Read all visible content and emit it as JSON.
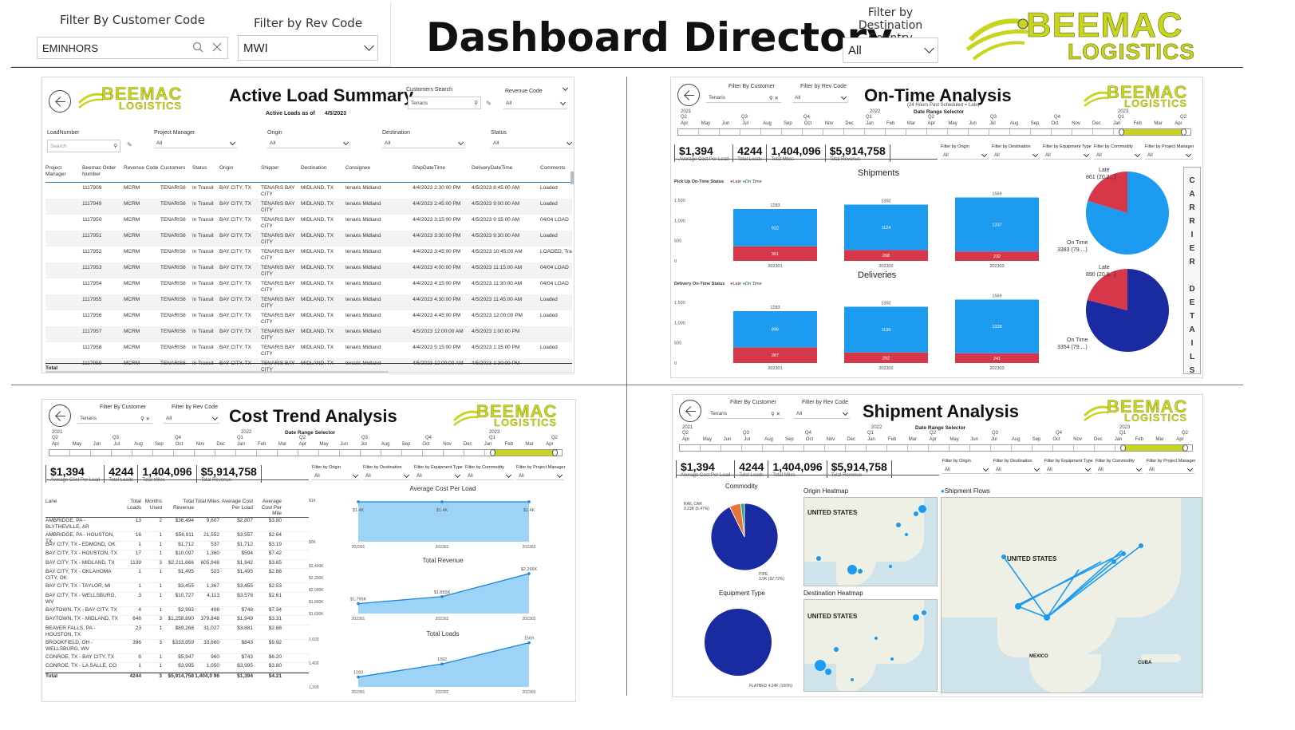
{
  "header": {
    "filter_customer_label": "Filter By Customer Code",
    "filter_customer_value": "EMINHORS",
    "filter_rev_label": "Filter by Rev Code",
    "filter_rev_value": "MWI",
    "title": "Dashboard Directory",
    "filter_dest_label": "Filter by Destination Country",
    "filter_dest_value": "All",
    "logo_top": "BEEMAC",
    "logo_bottom": "LOGISTICS"
  },
  "logo_small": {
    "top": "BEEMAC",
    "bottom": "LOGISTICS"
  },
  "active": {
    "title": "Active Load Summary",
    "as_of_label": "Active Loads as of",
    "as_of_date": "4/5/2023",
    "customers_search_label": "Customers Search",
    "customers_search_value": "Tenaris",
    "revenue_code_label": "Revenue Code",
    "revenue_code_value": "All",
    "loadnumber_label": "LoadNumber",
    "search_placeholder": "Search",
    "filters": [
      {
        "label": "Project Manager",
        "value": "All"
      },
      {
        "label": "Origin",
        "value": "All"
      },
      {
        "label": "Destination",
        "value": "All"
      },
      {
        "label": "Status",
        "value": "All"
      }
    ],
    "columns": [
      "Project Manager",
      "Beemac Order Number",
      "Revenue Code",
      "Customers",
      "Status",
      "Origin",
      "Shipper",
      "Destination",
      "Consignee",
      "ShipDateTime",
      "DeliveryDateTime",
      "Comments"
    ],
    "rows": [
      [
        "",
        "1117909",
        "MCRM",
        "TENARIS6",
        "In Transit",
        "BAY CITY, TX",
        "TENARIS BAY CITY",
        "MIDLAND, TX",
        "tenaris Midland",
        "4/4/2023 2:30:00 PM",
        "4/5/2023 8:45:00 AM",
        "Loaded"
      ],
      [
        "",
        "1117949",
        "MCRM",
        "TENARIS6",
        "In Transit",
        "BAY CITY, TX",
        "TENARIS BAY CITY",
        "MIDLAND, TX",
        "tenaris Midland",
        "4/4/2023 2:45:00 PM",
        "4/5/2023 9:00:00 AM",
        "Loaded"
      ],
      [
        "",
        "1117950",
        "MCRM",
        "TENARIS6",
        "In Transit",
        "BAY CITY, TX",
        "TENARIS BAY CITY",
        "MIDLAND, TX",
        "tenaris Midland",
        "4/4/2023 3:15:00 PM",
        "4/5/2023 9:15:00 AM",
        "04/04 LOAD"
      ],
      [
        "",
        "1117951",
        "MCRM",
        "TENARIS6",
        "In Transit",
        "BAY CITY, TX",
        "TENARIS BAY CITY",
        "MIDLAND, TX",
        "tenaris Midland",
        "4/4/2023 3:30:00 PM",
        "4/5/2023 9:30:00 AM",
        "Loaded"
      ],
      [
        "",
        "1117952",
        "MCRM",
        "TENARIS6",
        "In Transit",
        "BAY CITY, TX",
        "TENARIS BAY CITY",
        "MIDLAND, TX",
        "tenaris Midland",
        "4/4/2023 3:45:00 PM",
        "4/5/2023 10:45:00 AM",
        "LOADED, Tra"
      ],
      [
        "",
        "1117953",
        "MCRM",
        "TENARIS6",
        "In Transit",
        "BAY CITY, TX",
        "TENARIS BAY CITY",
        "MIDLAND, TX",
        "tenaris Midland",
        "4/4/2023 4:00:00 PM",
        "4/5/2023 11:15:00 AM",
        "04/04 LOAD"
      ],
      [
        "",
        "1117954",
        "MCRM",
        "TENARIS6",
        "In Transit",
        "BAY CITY, TX",
        "TENARIS BAY CITY",
        "MIDLAND, TX",
        "tenaris Midland",
        "4/4/2023 4:15:00 PM",
        "4/5/2023 11:30:00 AM",
        "04/04 LOAD"
      ],
      [
        "",
        "1117955",
        "MCRM",
        "TENARIS6",
        "In Transit",
        "BAY CITY, TX",
        "TENARIS BAY CITY",
        "MIDLAND, TX",
        "tenaris Midland",
        "4/4/2023 4:30:00 PM",
        "4/5/2023 11:45:00 AM",
        "Loaded"
      ],
      [
        "",
        "1117956",
        "MCRM",
        "TENARIS6",
        "In Transit",
        "BAY CITY, TX",
        "TENARIS BAY CITY",
        "MIDLAND, TX",
        "tenaris Midland",
        "4/4/2023 4:45:00 PM",
        "4/5/2023 12:00:00 PM",
        "Loaded"
      ],
      [
        "",
        "1117957",
        "MCRM",
        "TENARIS6",
        "In Transit",
        "BAY CITY, TX",
        "TENARIS BAY CITY",
        "MIDLAND, TX",
        "tenaris Midland",
        "4/5/2023 12:00:00 AM",
        "4/5/2023 1:00:00 PM",
        ""
      ],
      [
        "",
        "1117958",
        "MCRM",
        "TENARIS6",
        "In Transit",
        "BAY CITY, TX",
        "TENARIS BAY CITY",
        "MIDLAND, TX",
        "tenaris Midland",
        "4/4/2023 5:15:00 PM",
        "4/5/2023 1:15:00 PM",
        "Loaded"
      ],
      [
        "",
        "1117959",
        "MCRM",
        "TENARIS6",
        "In Transit",
        "BAY CITY, TX",
        "TENARIS BAY CITY",
        "MIDLAND, TX",
        "tenaris Midland",
        "4/5/2023 12:00:00 AM",
        "4/5/2023 1:30:00 PM",
        ""
      ]
    ],
    "total_label": "Total"
  },
  "common_filters": {
    "customer_label": "Filter By Customer",
    "customer_value": "Tenaris",
    "rev_label": "Filter by Rev Code",
    "rev_value": "All",
    "date_range_label": "Date Range Selector",
    "kpis": [
      {
        "value": "$1,394",
        "label": "Average Cost Per Load"
      },
      {
        "value": "4244",
        "label": "Total Loads"
      },
      {
        "value": "1,404,096",
        "label": "Total Miles"
      },
      {
        "value": "$5,914,758",
        "label": "Total Revenue"
      }
    ],
    "dd_filters": [
      {
        "label": "Filter by Origin",
        "value": "All"
      },
      {
        "label": "Filter by Destination",
        "value": "All"
      },
      {
        "label": "Filter by Equipment Type",
        "value": "All"
      },
      {
        "label": "Filter by Commodity",
        "value": "All"
      },
      {
        "label": "Filter by Project Manager",
        "value": "All"
      }
    ],
    "years": [
      "2021",
      "2022",
      "2023"
    ],
    "quarters": [
      "Q2",
      "Q3",
      "Q4",
      "Q1",
      "Q2",
      "Q3",
      "Q4",
      "Q1",
      "Q2"
    ],
    "months": [
      "Apr",
      "May",
      "Jun",
      "Jul",
      "Aug",
      "Sep",
      "Oct",
      "Nov",
      "Dec",
      "Jan",
      "Feb",
      "Mar",
      "Apr",
      "May",
      "Jun",
      "Jul",
      "Aug",
      "Sep",
      "Oct",
      "Nov",
      "Dec",
      "Jan",
      "Feb",
      "Mar",
      "Apr"
    ]
  },
  "ontime": {
    "title": "On-Time Analysis",
    "subtitle": "(24 Hours Past Scheduled = Late)",
    "shipments_title": "Shipments",
    "deliveries_title": "Deliveries",
    "pickup_legend": "Pick Up On-Time Status",
    "delivery_legend": "Delivery On-Time Status",
    "late": "Late",
    "ontime": "On Time",
    "carrier_details": "CARRIER DETAILS",
    "pie_ship": {
      "late": "Late",
      "late_val": "861 (20.2...)",
      "on": "On Time",
      "on_val": "3383 (79....)"
    },
    "pie_del": {
      "late": "Late",
      "late_val": "890 (20.9...)",
      "on": "On Time",
      "on_val": "3354 (79....)"
    }
  },
  "cost": {
    "title": "Cost Trend Analysis",
    "columns": [
      "Lane",
      "Total Loads",
      "Months Used",
      "Total Revenue",
      "Total Miles",
      "Average Cost Per Load",
      "Average Cost Per Mile"
    ],
    "rows": [
      [
        "AMBRIDGE, PA - BLYTHEVILLE, AR",
        "13",
        "2",
        "$36,494",
        "9,607",
        "$2,807",
        "$3.80"
      ],
      [
        "AMBRIDGE, PA - HOUSTON, TX",
        "16",
        "1",
        "$56,911",
        "21,552",
        "$3,557",
        "$2.64"
      ],
      [
        "BAY CITY, TX - EDMOND, OK",
        "1",
        "1",
        "$1,712",
        "537",
        "$1,712",
        "$3.19"
      ],
      [
        "BAY CITY, TX - HOUSTON, TX",
        "17",
        "1",
        "$10,097",
        "1,360",
        "$594",
        "$7.42"
      ],
      [
        "BAY CITY, TX - MIDLAND, TX",
        "1139",
        "3",
        "$2,211,666",
        "605,948",
        "$1,942",
        "$3.65"
      ],
      [
        "BAY CITY, TX - OKLAHOMA CITY, OK",
        "1",
        "1",
        "$1,495",
        "523",
        "$1,495",
        "$2.86"
      ],
      [
        "BAY CITY, TX - TAYLOR, MI",
        "1",
        "1",
        "$3,455",
        "1,367",
        "$3,455",
        "$2.53"
      ],
      [
        "BAY CITY, TX - WELLSBURG, WV",
        "3",
        "1",
        "$10,727",
        "4,113",
        "$3,576",
        "$2.61"
      ],
      [
        "BAYTOWN, TX - BAY CITY, TX",
        "4",
        "1",
        "$2,993",
        "408",
        "$748",
        "$7.34"
      ],
      [
        "BAYTOWN, TX - MIDLAND, TX",
        "646",
        "3",
        "$1,258,890",
        "379,848",
        "$1,949",
        "$3.31"
      ],
      [
        "BEAVER FALLS, PA - HOUSTON, TX",
        "23",
        "1",
        "$89,268",
        "31,027",
        "$3,881",
        "$2.88"
      ],
      [
        "BROOKFIELD, OH - WELLSBURG, WV",
        "396",
        "3",
        "$333,859",
        "33,660",
        "$843",
        "$9.92"
      ],
      [
        "CONROE, TX - BAY CITY, TX",
        "8",
        "1",
        "$5,947",
        "960",
        "$743",
        "$6.20"
      ],
      [
        "CONROE, TX - LA SALLE, CO",
        "1",
        "1",
        "$3,995",
        "1,050",
        "$3,995",
        "$3.80"
      ]
    ],
    "total": [
      "Total",
      "4244",
      "3",
      "$5,914,758",
      "1,404,0 96",
      "$1,394",
      "$4.21"
    ],
    "chart_titles": [
      "Average Cost Per Load",
      "Total Revenue",
      "Total Loads"
    ]
  },
  "shipment": {
    "title": "Shipment Analysis",
    "commodity_title": "Commodity",
    "equipment_title": "Equipment Type",
    "origin_heatmap": "Origin Heatmap",
    "dest_heatmap": "Destination Heatmap",
    "flows_title": "Shipment Flows",
    "rail_car": "RAIL CAR",
    "rail_car_val": "0.23K (5.47%)",
    "pipe": "PIPE",
    "pipe_val": "3.9K (92.72%)",
    "flatbed": "FLATBED 4.24K (100%)",
    "us_label": "UNITED STATES",
    "mexico": "MEXICO",
    "cuba": "CUBA"
  },
  "colors": {
    "blue": "#1c9bf0",
    "red": "#d6384a",
    "navy": "#1a2aa0",
    "accent": "#c8d41e"
  },
  "chart_data": [
    {
      "type": "bar",
      "title": "Shipments",
      "categories": [
        "202301",
        "202302",
        "202303"
      ],
      "series": [
        {
          "name": "Late",
          "values": [
            361,
            268,
            232
          ]
        },
        {
          "name": "On Time",
          "values": [
            922,
            1124,
            1337
          ]
        }
      ],
      "totals": [
        1283,
        1392,
        1569
      ],
      "ylim": [
        0,
        1500
      ]
    },
    {
      "type": "bar",
      "title": "Deliveries",
      "categories": [
        "202301",
        "202302",
        "202303"
      ],
      "series": [
        {
          "name": "Late",
          "values": [
            387,
            262,
            241
          ]
        },
        {
          "name": "On Time",
          "values": [
            896,
            1130,
            1328
          ]
        }
      ],
      "totals": [
        1283,
        1392,
        1569
      ],
      "ylim": [
        0,
        1500
      ]
    },
    {
      "type": "pie",
      "title": "",
      "series": [
        {
          "name": "Late",
          "values": [
            861
          ]
        },
        {
          "name": "On Time",
          "values": [
            3383
          ]
        }
      ]
    },
    {
      "type": "pie",
      "title": "",
      "series": [
        {
          "name": "Late",
          "values": [
            890
          ]
        },
        {
          "name": "On Time",
          "values": [
            3354
          ]
        }
      ]
    },
    {
      "type": "area",
      "title": "Average Cost Per Load",
      "categories": [
        "202301",
        "202302",
        "202303"
      ],
      "values": [
        1400,
        1400,
        1400
      ],
      "labels": [
        "$1.4K",
        "$1.4K",
        "$1.4K"
      ],
      "yticks": [
        "$1K",
        "$0K"
      ]
    },
    {
      "type": "line",
      "title": "Total Revenue",
      "categories": [
        "202301",
        "202302",
        "202303"
      ],
      "values": [
        1765,
        1883,
        2266
      ],
      "labels": [
        "$1,765K",
        "$1,883K",
        "$2,266K"
      ],
      "yticks": [
        "$2,400K",
        "$2,200K",
        "$2,000K",
        "$1,800K",
        "$1,600K"
      ],
      "ylim": [
        1600,
        2400
      ]
    },
    {
      "type": "line",
      "title": "Total Loads",
      "categories": [
        "202301",
        "202302",
        "202303"
      ],
      "values": [
        1283,
        1392,
        1569
      ],
      "labels": [
        "1283",
        "1392",
        "1569"
      ],
      "yticks": [
        "1,600",
        "1,400",
        "1,200"
      ],
      "ylim": [
        1200,
        1600
      ]
    },
    {
      "type": "pie",
      "title": "Commodity",
      "series": [
        {
          "name": "PIPE",
          "values": [
            92.72
          ]
        },
        {
          "name": "RAIL CAR",
          "values": [
            5.47
          ]
        },
        {
          "name": "Other",
          "values": [
            1.81
          ]
        }
      ]
    },
    {
      "type": "pie",
      "title": "Equipment Type",
      "series": [
        {
          "name": "FLATBED",
          "values": [
            100
          ]
        }
      ]
    }
  ]
}
